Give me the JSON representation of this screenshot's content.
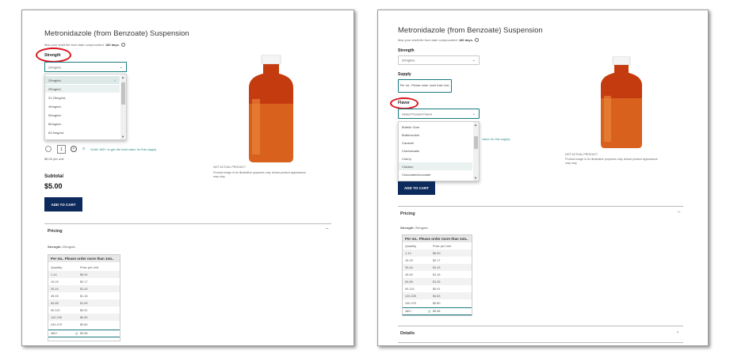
{
  "left": {
    "title": "Metronidazole (from Benzoate) Suspension",
    "shelf_life_prefix": "Max your shelf-life from date compounded: ",
    "shelf_life_days": "180 days.",
    "strength_label": "Strength",
    "strength_value": "20mg/mL",
    "strength_options": [
      "20mg/mL",
      "25mg/mL",
      "31.25mg/mL",
      "40mg/mL",
      "50mg/mL",
      "80mg/mL",
      "62.5mg/mL"
    ],
    "quantity_value": "1",
    "buy_more_text": "Order 480+ to get the best value for this supply",
    "price_per_unit": "$5.00 per unit",
    "image_caption_1": "Product image is for illustrative purposes only. Actual product appearance",
    "image_caption_2": "may vary.",
    "image_sub_caption": "NOT ACTUAL PRODUCT",
    "subtotal_label": "Subtotal",
    "subtotal_value": "$5.00",
    "add_to_cart": "ADD TO CART",
    "pricing_label": "Pricing",
    "pricing_toggle": "–",
    "strength_line_label": "Strength:",
    "strength_line_value": "20mg/mL",
    "table_header": "Per mL. Please order more than 1mL.",
    "col_quantity": "Quantity",
    "col_price": "Price per Unit",
    "rows": [
      {
        "q": "1-14",
        "p": "$5.00"
      },
      {
        "q": "15-29",
        "p": "$2.17"
      },
      {
        "q": "30-44",
        "p": "$1.43"
      },
      {
        "q": "45-59",
        "p": "$1.18"
      },
      {
        "q": "60-89",
        "p": "$1.05"
      },
      {
        "q": "90-119",
        "p": "$0.91"
      },
      {
        "q": "120-239",
        "p": "$0.83"
      },
      {
        "q": "240-479",
        "p": "$0.80"
      },
      {
        "q": "480+",
        "p": "$0.58"
      }
    ]
  },
  "right": {
    "title": "Metronidazole (from Benzoate) Suspension",
    "shelf_life_prefix": "Max your shelf-life from date compounded: ",
    "shelf_life_days": "180 days.",
    "strength_label": "Strength",
    "strength_value": "20mg/mL",
    "supply_label": "Supply",
    "supply_option": "Per mL. Please order more than 1mL",
    "flavor_label": "Flavor",
    "flavor_placeholder": "Select Product Flavor",
    "flavor_options": [
      "Bubble Gum",
      "Butterscotch",
      "Caramel",
      "Cheesecake",
      "Cherry",
      "Chicken",
      "Chocolate/chocolate"
    ],
    "buy_more_text": "value for this supply",
    "image_caption_1": "Product image is for illustrative purposes only. Actual product appearance",
    "image_caption_2": "may vary.",
    "image_sub_caption": "NOT ACTUAL PRODUCT",
    "add_to_cart": "ADD TO CART",
    "pricing_label": "Pricing",
    "pricing_toggle": "–",
    "strength_line_label": "Strength:",
    "strength_line_value": "20mg/mL",
    "table_header": "Per mL. Please order more than 1mL.",
    "col_quantity": "Quantity",
    "col_price": "Price per Unit",
    "rows": [
      {
        "q": "1-14",
        "p": "$5.00"
      },
      {
        "q": "15-29",
        "p": "$2.17"
      },
      {
        "q": "30-44",
        "p": "$1.43"
      },
      {
        "q": "45-59",
        "p": "$1.18"
      },
      {
        "q": "60-89",
        "p": "$1.05"
      },
      {
        "q": "90-119",
        "p": "$0.91"
      },
      {
        "q": "120-239",
        "p": "$0.83"
      },
      {
        "q": "240-479",
        "p": "$0.80"
      },
      {
        "q": "480+",
        "p": "$0.58"
      }
    ],
    "details_label": "Details",
    "details_toggle": "›"
  }
}
